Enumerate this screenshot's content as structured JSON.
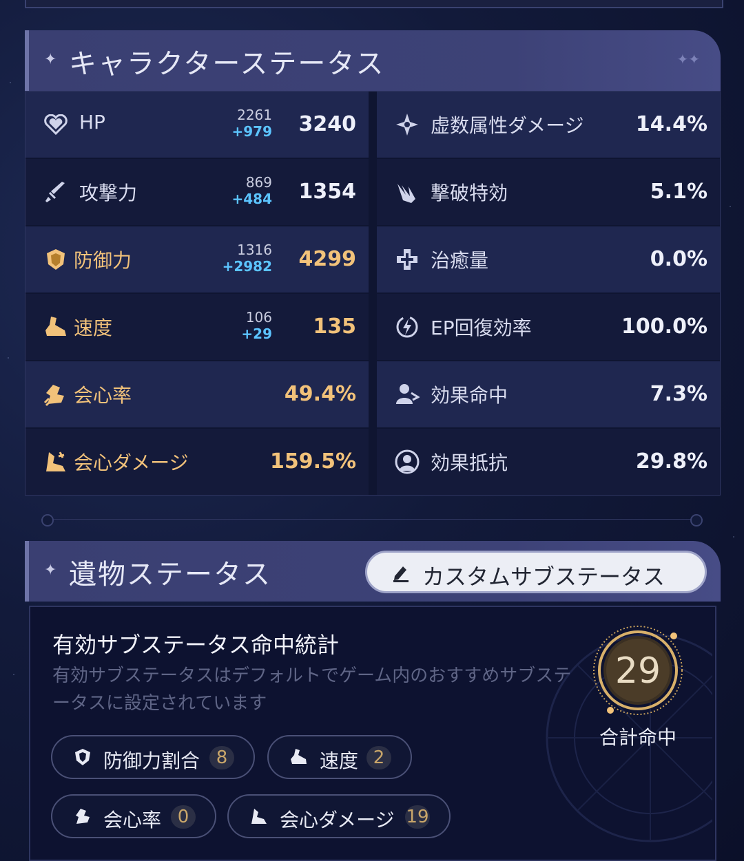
{
  "character_status": {
    "title": "キャラクターステータス",
    "stats": [
      {
        "label": "HP",
        "icon": "heart-icon",
        "base": "2261",
        "bonus": "+979",
        "value": "3240",
        "highlight": false
      },
      {
        "label": "虚数属性ダメージ",
        "icon": "imaginary-element-icon",
        "value": "14.4%",
        "highlight": false
      },
      {
        "label": "攻撃力",
        "icon": "sword-icon",
        "base": "869",
        "bonus": "+484",
        "value": "1354",
        "highlight": false
      },
      {
        "label": "撃破特効",
        "icon": "break-effect-icon",
        "value": "5.1%",
        "highlight": false
      },
      {
        "label": "防御力",
        "icon": "shield-icon",
        "base": "1316",
        "bonus": "+2982",
        "value": "4299",
        "highlight": true
      },
      {
        "label": "治癒量",
        "icon": "healing-cross-icon",
        "value": "0.0%",
        "highlight": false
      },
      {
        "label": "速度",
        "icon": "boot-icon",
        "base": "106",
        "bonus": "+29",
        "value": "135",
        "highlight": true
      },
      {
        "label": "EP回復効率",
        "icon": "energy-regen-icon",
        "value": "100.0%",
        "highlight": false
      },
      {
        "label": "会心率",
        "icon": "crit-rate-icon",
        "value": "49.4%",
        "highlight": true
      },
      {
        "label": "効果命中",
        "icon": "effect-hit-icon",
        "value": "7.3%",
        "highlight": false
      },
      {
        "label": "会心ダメージ",
        "icon": "crit-dmg-icon",
        "value": "159.5%",
        "highlight": true
      },
      {
        "label": "効果抵抗",
        "icon": "effect-res-icon",
        "value": "29.8%",
        "highlight": false
      }
    ]
  },
  "relic_status": {
    "title": "遺物ステータス",
    "custom_button": "カスタムサブステータス",
    "summary_title": "有効サブステータス命中統計",
    "summary_desc": "有効サブステータスはデフォルトでゲーム内のおすすめサブステータスに設定されています",
    "total": "29",
    "total_label": "合計命中",
    "chips": [
      {
        "label": "防御力割合",
        "count": "8",
        "icon": "shield-icon"
      },
      {
        "label": "速度",
        "count": "2",
        "icon": "boot-icon"
      },
      {
        "label": "会心率",
        "count": "0",
        "icon": "crit-rate-icon"
      },
      {
        "label": "会心ダメージ",
        "count": "19",
        "icon": "crit-dmg-icon"
      }
    ]
  },
  "colors": {
    "gold": "#f2c27a",
    "blue": "#5cc4ff",
    "panel": "#141a3a",
    "header": "#3a3f72"
  }
}
